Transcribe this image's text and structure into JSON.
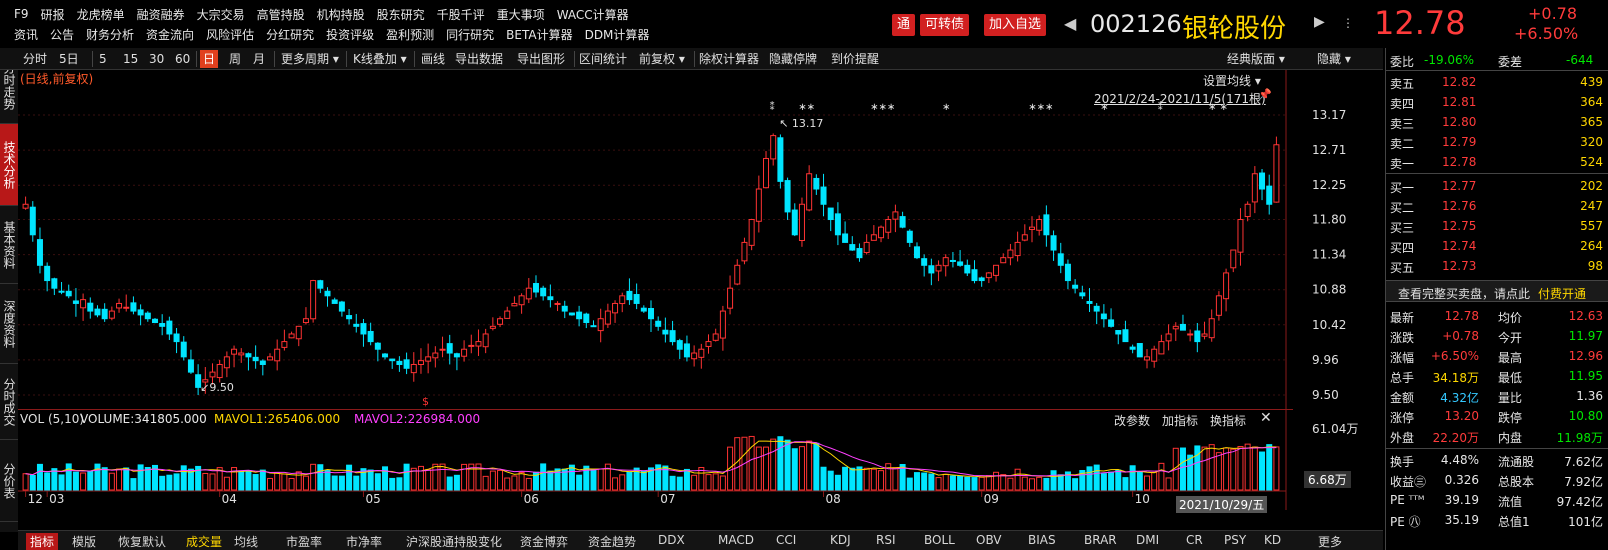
{
  "topnav": {
    "row1": [
      "F9",
      "研报",
      "龙虎榜单",
      "融资融券",
      "大宗交易",
      "高管持股",
      "机构持股",
      "股东研究",
      "千股千评",
      "重大事项",
      "WACC计算器"
    ],
    "row2": [
      "资讯",
      "公告",
      "财务分析",
      "资金流向",
      "风险评估",
      "分红研究",
      "投资评级",
      "盈利预测",
      "同行研究",
      "BETA计算器",
      "DDM计算器"
    ]
  },
  "header": {
    "btn_tong": "通",
    "btn_kzz": "可转债",
    "btn_add": "加入自选",
    "code": "002126",
    "name": "银轮股份",
    "price": "12.78",
    "change": "+0.78",
    "change_pct": "+6.50%",
    "colors": {
      "up": "#ff3b3b",
      "down": "#00e600",
      "accent": "#d12020"
    }
  },
  "toolbar": {
    "items": [
      "分时",
      "5日",
      "5",
      "15",
      "30",
      "60",
      "日",
      "周",
      "月",
      "更多周期 ▾",
      "K线叠加 ▾",
      "画线",
      "导出数据",
      "导出图形",
      "区间统计",
      "前复权 ▾",
      "除权计算器",
      "隐藏停牌",
      "到价提醒"
    ],
    "active": "日",
    "right_items": [
      "经典版面 ▾",
      "隐藏 ▾"
    ]
  },
  "leftbar": [
    {
      "label": "分时走势",
      "active": false
    },
    {
      "label": "技术分析",
      "active": true
    },
    {
      "label": "基本资料",
      "active": false
    },
    {
      "label": "深度资料",
      "active": false
    },
    {
      "label": "分时成交",
      "active": false
    },
    {
      "label": "分价表",
      "active": false
    }
  ],
  "kline": {
    "label": "(日线,前复权)",
    "settings": "设置均线 ▾",
    "range_text": "2021/2/24-2021/11/5(171根)",
    "y_ticks": [
      "13.17",
      "12.71",
      "12.25",
      "11.80",
      "11.34",
      "10.88",
      "10.42",
      "9.96",
      "9.50"
    ],
    "high_label": "13.17",
    "low_label": "9.50"
  },
  "volume": {
    "label": "VOL (5,10)",
    "volume": "VOLUME:341805.000",
    "ma1": "MAVOL1:265406.000",
    "ma2": "MAVOL2:226984.000",
    "btn_params": "改参数",
    "btn_add": "加指标",
    "btn_switch": "换指标",
    "y_top": "61.04万",
    "last_tag": "6.68万",
    "x_labels": [
      "12",
      "03",
      "04",
      "05",
      "06",
      "07",
      "08",
      "09",
      "10"
    ],
    "date_tag": "2021/10/29/五"
  },
  "bottom_tabs": [
    "指标",
    "模版",
    "恢复默认",
    "成交量",
    "均线",
    "市盈率",
    "市净率",
    "沪深股通持股变化",
    "资金博弈",
    "资金趋势",
    "DDX",
    "MACD",
    "CCI",
    "KDJ",
    "RSI",
    "BOLL",
    "OBV",
    "BIAS",
    "BRAR",
    "DMI",
    "CR",
    "PSY",
    "KD",
    "更多"
  ],
  "order_book": {
    "wei_bi_label": "委比",
    "wei_bi": "-19.06%",
    "wei_cha_label": "委差",
    "wei_cha": "-644",
    "sells": [
      {
        "label": "卖五",
        "price": "12.82",
        "vol": "439"
      },
      {
        "label": "卖四",
        "price": "12.81",
        "vol": "364"
      },
      {
        "label": "卖三",
        "price": "12.80",
        "vol": "365"
      },
      {
        "label": "卖二",
        "price": "12.79",
        "vol": "320"
      },
      {
        "label": "卖一",
        "price": "12.78",
        "vol": "524"
      }
    ],
    "buys": [
      {
        "label": "买一",
        "price": "12.77",
        "vol": "202"
      },
      {
        "label": "买二",
        "price": "12.76",
        "vol": "247"
      },
      {
        "label": "买三",
        "price": "12.75",
        "vol": "557"
      },
      {
        "label": "买四",
        "price": "12.74",
        "vol": "264"
      },
      {
        "label": "买五",
        "price": "12.73",
        "vol": "98"
      }
    ],
    "full_book_text": "查看完整买卖盘，请点此",
    "full_book_link": "付费开通"
  },
  "quote": [
    {
      "l1": "最新",
      "v1": "12.78",
      "c1": "red",
      "l2": "均价",
      "v2": "12.63",
      "c2": "red"
    },
    {
      "l1": "涨跌",
      "v1": "+0.78",
      "c1": "red",
      "l2": "今开",
      "v2": "11.97",
      "c2": "green"
    },
    {
      "l1": "涨幅",
      "v1": "+6.50%",
      "c1": "red",
      "l2": "最高",
      "v2": "12.96",
      "c2": "red"
    },
    {
      "l1": "总手",
      "v1": "34.18万",
      "c1": "yellow",
      "l2": "最低",
      "v2": "11.95",
      "c2": "green"
    },
    {
      "l1": "金额",
      "v1": "4.32亿",
      "c1": "cyan",
      "l2": "量比",
      "v2": "1.36",
      "c2": "white"
    },
    {
      "l1": "涨停",
      "v1": "13.20",
      "c1": "red",
      "l2": "跌停",
      "v2": "10.80",
      "c2": "green"
    },
    {
      "l1": "外盘",
      "v1": "22.20万",
      "c1": "red",
      "l2": "内盘",
      "v2": "11.98万",
      "c2": "green"
    }
  ],
  "quote2": [
    {
      "l1": "换手",
      "v1": "4.48%",
      "l2": "流通股",
      "v2": "7.62亿"
    },
    {
      "l1": "收益㊂",
      "v1": "0.326",
      "l2": "总股本",
      "v2": "7.92亿"
    },
    {
      "l1": "PE ᵀᵀᴹ",
      "v1": "39.19",
      "l2": "流值",
      "v2": "97.42亿"
    },
    {
      "l1": "PE ㊇",
      "v1": "35.19",
      "l2": "总值1",
      "v2": "101亿"
    }
  ],
  "chart_data": {
    "type": "candlestick",
    "ylim": [
      9.5,
      13.17
    ],
    "series_close": [
      12.0,
      11.6,
      11.2,
      11.0,
      10.9,
      10.85,
      10.8,
      10.7,
      10.75,
      10.6,
      10.55,
      10.5,
      10.6,
      10.7,
      10.65,
      10.6,
      10.55,
      10.5,
      10.45,
      10.4,
      10.3,
      10.2,
      10.0,
      9.8,
      9.6,
      9.7,
      9.8,
      9.9,
      10.0,
      10.1,
      10.05,
      10.0,
      9.95,
      9.9,
      10.0,
      10.1,
      10.2,
      10.3,
      10.4,
      10.5,
      11.0,
      10.9,
      10.8,
      10.7,
      10.6,
      10.5,
      10.4,
      10.3,
      10.2,
      10.1,
      10.0,
      9.95,
      9.9,
      9.85,
      9.9,
      9.95,
      10.0,
      10.05,
      10.1,
      10.05,
      10.0,
      10.1,
      10.15,
      10.2,
      10.3,
      10.4,
      10.5,
      10.6,
      10.7,
      10.8,
      10.9,
      10.85,
      10.8,
      10.75,
      10.7,
      10.6,
      10.55,
      10.5,
      10.45,
      10.4,
      10.5,
      10.6,
      10.7,
      10.8,
      10.75,
      10.7,
      10.6,
      10.5,
      10.4,
      10.3,
      10.2,
      10.1,
      10.0,
      10.05,
      10.1,
      10.2,
      10.3,
      10.6,
      10.9,
      11.2,
      11.5,
      11.8,
      12.2,
      12.6,
      12.9,
      12.3,
      11.9,
      11.6,
      12.0,
      12.4,
      12.2,
      12.0,
      11.8,
      11.6,
      11.5,
      11.4,
      11.3,
      11.5,
      11.6,
      11.7,
      11.8,
      11.9,
      11.7,
      11.5,
      11.3,
      11.2,
      11.1,
      11.2,
      11.3,
      11.25,
      11.2,
      11.1,
      11.0,
      11.0,
      11.1,
      11.2,
      11.3,
      11.4,
      11.5,
      11.6,
      11.7,
      11.8,
      11.6,
      11.4,
      11.2,
      11.0,
      10.9,
      10.8,
      10.7,
      10.6,
      10.5,
      10.4,
      10.3,
      10.2,
      10.1,
      10.0,
      10.0,
      10.1,
      10.2,
      10.3,
      10.4,
      10.35,
      10.3,
      10.2,
      10.3,
      10.5,
      10.8,
      11.1,
      11.4,
      11.8,
      12.0,
      12.4,
      12.2,
      12.0,
      12.78
    ]
  }
}
